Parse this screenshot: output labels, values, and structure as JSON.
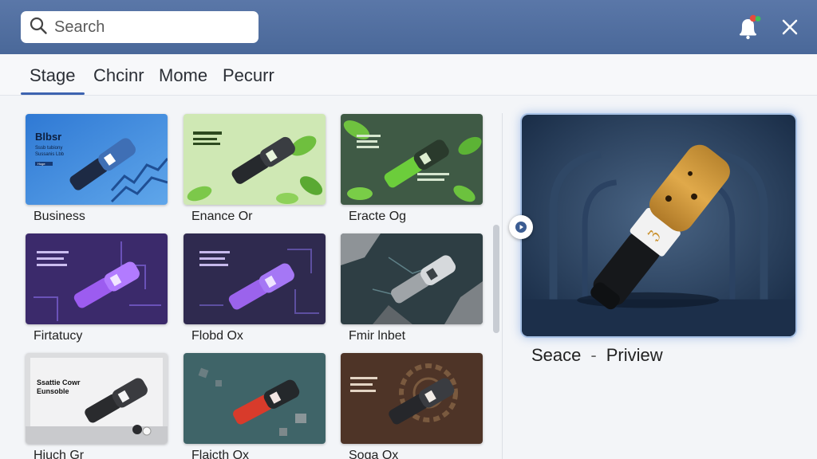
{
  "search": {
    "placeholder": "Search",
    "value": ""
  },
  "header": {
    "notification_icon": "bell-icon",
    "close_icon": "close-icon"
  },
  "tabs": [
    {
      "label": "Stage",
      "active": true
    },
    {
      "label": "Chcinr",
      "active": false
    },
    {
      "label": "Mome",
      "active": false
    },
    {
      "label": "Pecurr",
      "active": false
    }
  ],
  "templates": [
    {
      "label": "Business",
      "theme": "blue"
    },
    {
      "label": "Enance Or",
      "theme": "green-light"
    },
    {
      "label": "Eracte Og",
      "theme": "green-dark"
    },
    {
      "label": "Firtatucy",
      "theme": "purple"
    },
    {
      "label": "Flobd Ox",
      "theme": "purple-dark"
    },
    {
      "label": "Fmir lnbet",
      "theme": "grey-rock"
    },
    {
      "label": "Hiuch Gr",
      "theme": "white"
    },
    {
      "label": "Flaicth Ox",
      "theme": "teal-red"
    },
    {
      "label": "Soga Ox",
      "theme": "brown-gear"
    }
  ],
  "thumb_text": {
    "business": [
      "Blbsr",
      "Sssb tubiony",
      "Sussanis Lbb",
      "Hoge"
    ],
    "white": [
      "Ssattie Cowr",
      "Eunsoble"
    ]
  },
  "preview": {
    "caption_left": "Seace",
    "caption_sep": "-",
    "caption_right": "Priview",
    "play_icon": "play-icon"
  },
  "colors": {
    "header": "#4f6ea0",
    "accent": "#3d63b0",
    "preview_border": "#a8c2e6"
  }
}
